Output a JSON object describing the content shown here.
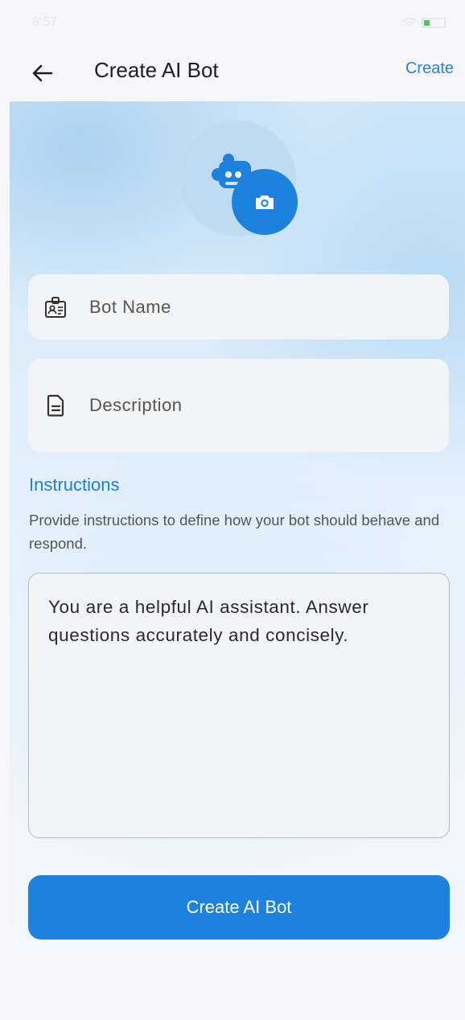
{
  "status_bar": {
    "time": "8:57",
    "battery_color": "#3ccf4e"
  },
  "app_bar": {
    "title": "Create AI Bot",
    "action_label": "Create",
    "back_icon": "arrow-left-icon"
  },
  "avatar": {
    "bot_icon": "bot-puzzle-icon",
    "camera_icon": "camera-icon"
  },
  "fields": {
    "bot_name": {
      "placeholder": "Bot Name",
      "icon": "id-badge-icon"
    },
    "description": {
      "placeholder": "Description",
      "icon": "document-icon"
    }
  },
  "instructions": {
    "title": "Instructions",
    "help": "Provide instructions to define how your bot should behave and respond.",
    "value": "You are a helpful AI assistant. Answer questions accurately and concisely."
  },
  "primary_button": {
    "label": "Create AI Bot"
  },
  "colors": {
    "accent": "#1c82dd",
    "link": "#2e7ed2",
    "background": "#f7f7f9"
  }
}
